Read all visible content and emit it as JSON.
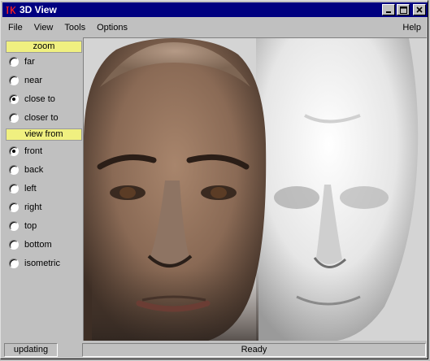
{
  "window": {
    "title": "3D View",
    "app_icon": "tk-feather-icon"
  },
  "menubar": {
    "items": [
      "File",
      "View",
      "Tools",
      "Options"
    ],
    "help": "Help"
  },
  "sidebar": {
    "zoom_label": "zoom",
    "zoom_options": [
      {
        "label": "far",
        "selected": false
      },
      {
        "label": "near",
        "selected": false
      },
      {
        "label": "close to",
        "selected": true
      },
      {
        "label": "closer to",
        "selected": false
      }
    ],
    "view_label": "view from",
    "view_options": [
      {
        "label": "front",
        "selected": true
      },
      {
        "label": "back",
        "selected": false
      },
      {
        "label": "left",
        "selected": false
      },
      {
        "label": "right",
        "selected": false
      },
      {
        "label": "top",
        "selected": false
      },
      {
        "label": "bottom",
        "selected": false
      },
      {
        "label": "isometric",
        "selected": false
      }
    ]
  },
  "status": {
    "left": "updating",
    "main": "Ready"
  },
  "colors": {
    "title_bar": "#000080",
    "section_label_bg": "#f0f080",
    "chrome": "#c0c0c0"
  }
}
